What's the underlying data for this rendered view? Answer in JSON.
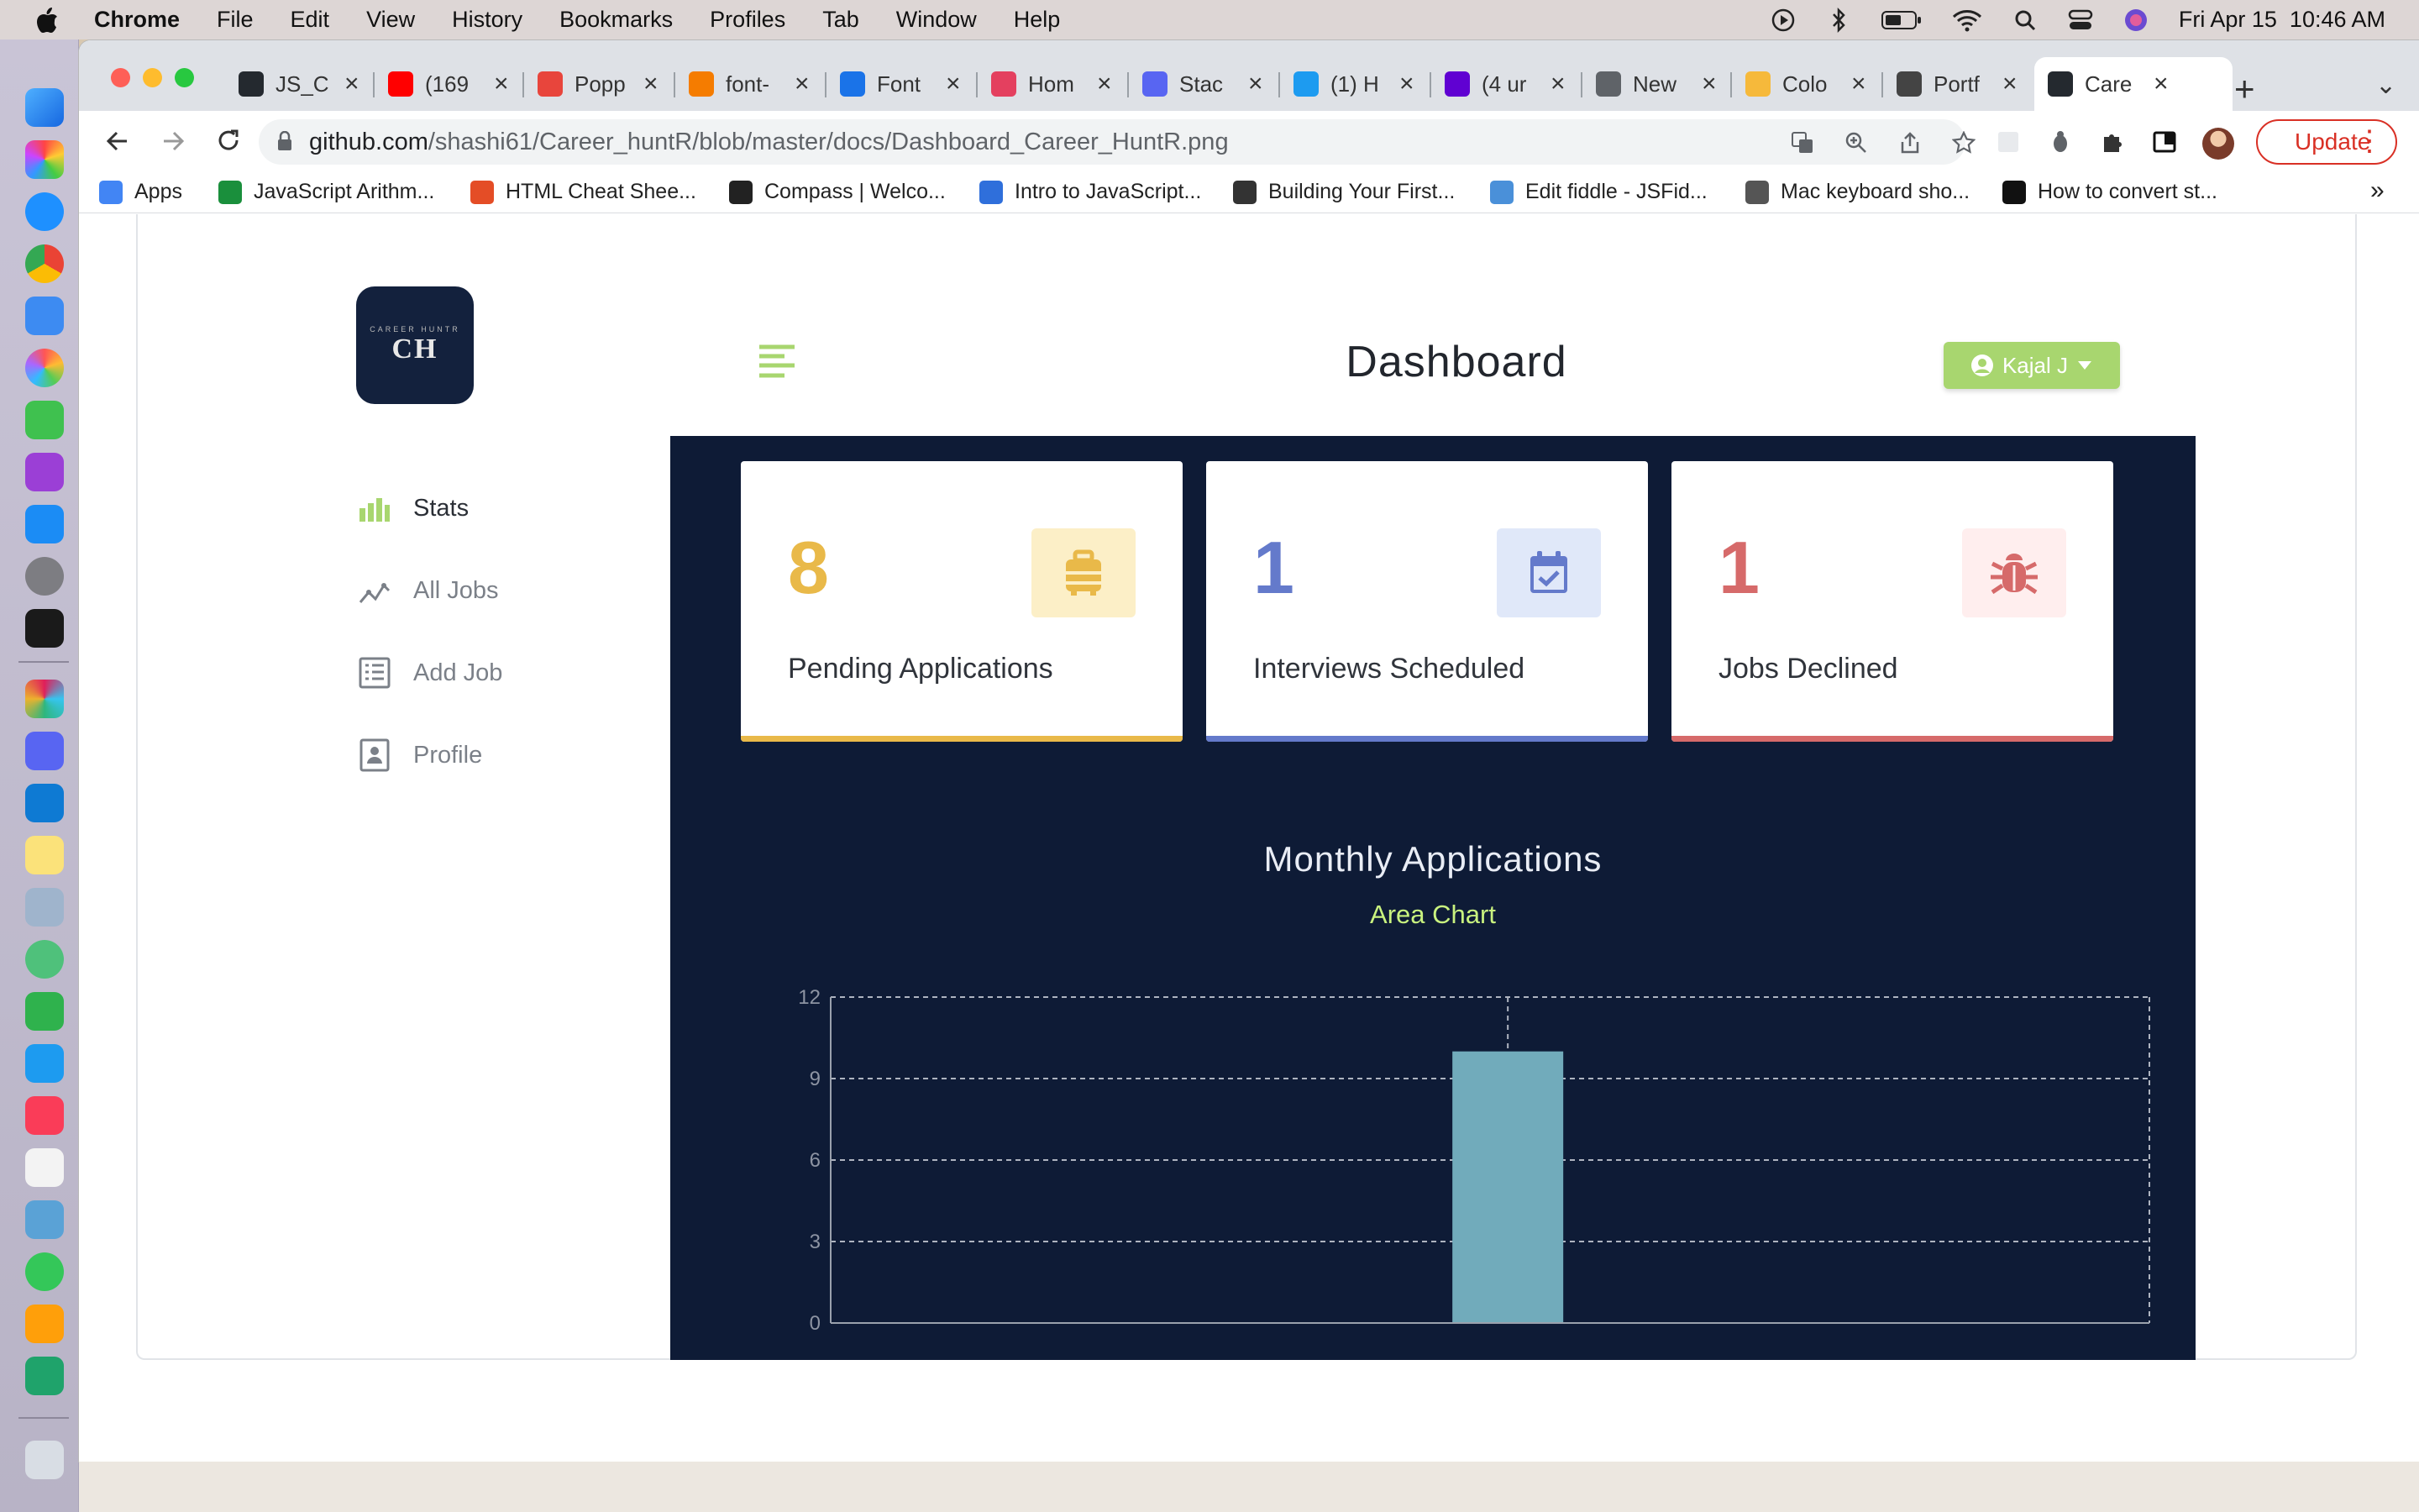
{
  "menubar": {
    "items": [
      "Chrome",
      "File",
      "Edit",
      "View",
      "History",
      "Bookmarks",
      "Profiles",
      "Tab",
      "Window",
      "Help"
    ],
    "datetime": "Fri Apr 15  10:46 AM"
  },
  "tabs": [
    {
      "title": "JS_C",
      "color": "#24292f",
      "active": false
    },
    {
      "title": "(169",
      "color": "#ff0000",
      "active": false
    },
    {
      "title": "Popp",
      "color": "#e8453c",
      "active": false
    },
    {
      "title": "font-",
      "color": "#f57c00",
      "active": false
    },
    {
      "title": "Font",
      "color": "#1a73e8",
      "active": false
    },
    {
      "title": "Hom",
      "color": "#e4405f",
      "active": false
    },
    {
      "title": "Stac",
      "color": "#5865f2",
      "active": false
    },
    {
      "title": "(1) H",
      "color": "#1d9bf0",
      "active": false
    },
    {
      "title": "(4 ur",
      "color": "#6001d2",
      "active": false
    },
    {
      "title": "New",
      "color": "#5f6368",
      "active": false
    },
    {
      "title": "Colo",
      "color": "#f6b93b",
      "active": false
    },
    {
      "title": "Portf",
      "color": "#444444",
      "active": false
    },
    {
      "title": "Care",
      "color": "#24292f",
      "active": true
    }
  ],
  "address": {
    "domain": "github.com",
    "path": "/shashi61/Career_huntR/blob/master/docs/Dashboard_Career_HuntR.png"
  },
  "update_label": "Update",
  "bookmarks": [
    {
      "label": "Apps",
      "color": "#4285f4"
    },
    {
      "label": "JavaScript Arithm...",
      "color": "#1a8f3c"
    },
    {
      "label": "HTML Cheat Shee...",
      "color": "#e44d26"
    },
    {
      "label": "Compass | Welco...",
      "color": "#222222"
    },
    {
      "label": "Intro to JavaScript...",
      "color": "#2f6fdb"
    },
    {
      "label": "Building Your First...",
      "color": "#333333"
    },
    {
      "label": "Edit fiddle - JSFid...",
      "color": "#4a90d9"
    },
    {
      "label": "Mac keyboard sho...",
      "color": "#555555"
    },
    {
      "label": "How to convert st...",
      "color": "#111111"
    }
  ],
  "logo": {
    "subtitle": "CAREER HUNTR",
    "main": "CH"
  },
  "sidebar": {
    "items": [
      {
        "label": "Stats",
        "icon": "bar-chart-icon",
        "active": true
      },
      {
        "label": "All Jobs",
        "icon": "trend-line-icon",
        "active": false
      },
      {
        "label": "Add Job",
        "icon": "form-icon",
        "active": false
      },
      {
        "label": "Profile",
        "icon": "id-card-icon",
        "active": false
      }
    ]
  },
  "header": {
    "title": "Dashboard",
    "user": "Kajal J"
  },
  "stats": [
    {
      "value": "8",
      "label": "Pending Applications",
      "icon": "briefcase-icon",
      "color": "#e9b949",
      "bg": "#fcefc7"
    },
    {
      "value": "1",
      "label": "Interviews Scheduled",
      "icon": "calendar-check-icon",
      "color": "#647acb",
      "bg": "#e0e8f9"
    },
    {
      "value": "1",
      "label": "Jobs Declined",
      "icon": "bug-icon",
      "color": "#d66a6a",
      "bg": "#ffeeee"
    }
  ],
  "chart_heading": {
    "title": "Monthly Applications",
    "subtitle": "Area Chart"
  },
  "chart_data": {
    "type": "bar",
    "categories": [
      ""
    ],
    "values": [
      10
    ],
    "ylim": [
      0,
      12
    ],
    "yticks": [
      0,
      3,
      6,
      9,
      12
    ],
    "grid": true,
    "bar_color": "#71abbb",
    "grid_color": "#aeb4c0"
  }
}
